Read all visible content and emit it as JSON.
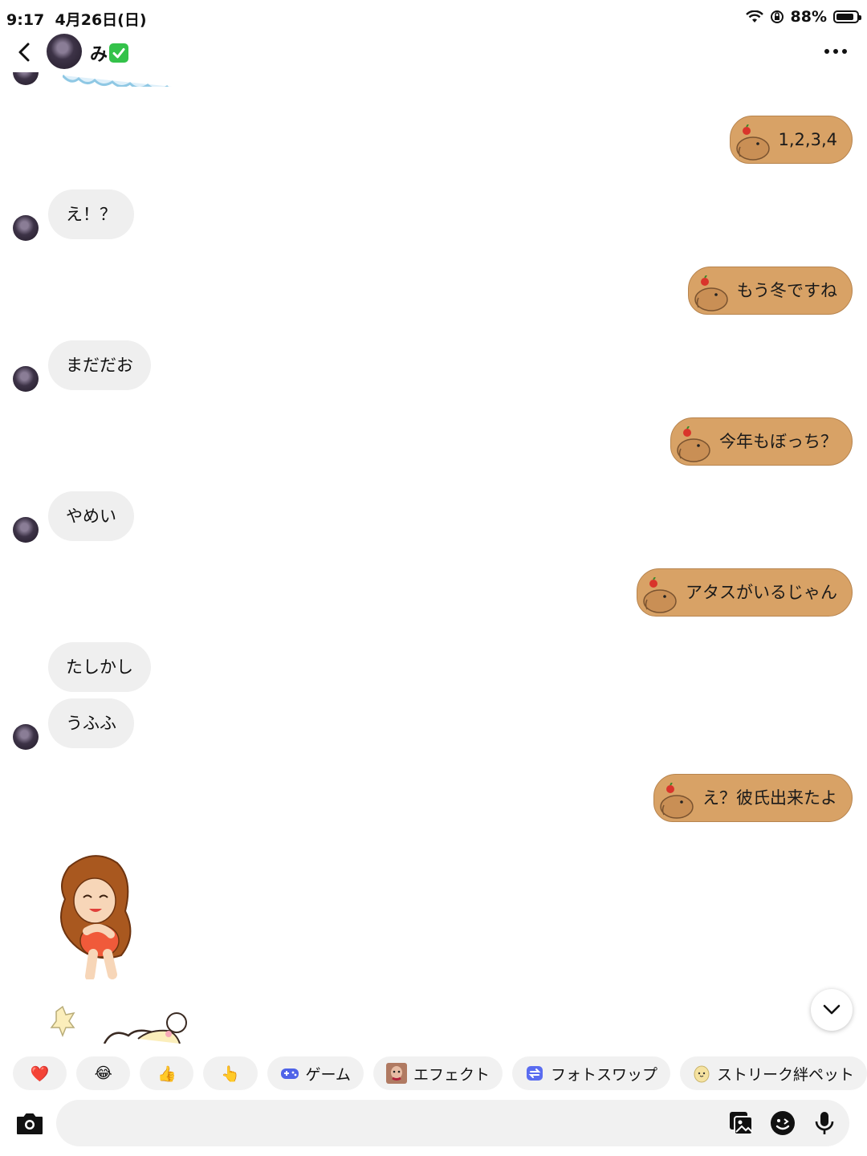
{
  "status_bar": {
    "time": "9:17",
    "date": "4月26日(日)",
    "battery": "88%",
    "battery_level": 0.88
  },
  "header": {
    "contact_name": "み",
    "verified_emoji": "✅",
    "back_icon": "chevron-left-icon",
    "more_icon": "ellipsis-icon"
  },
  "messages": [
    {
      "direction": "outgoing",
      "text": "1,2,3,4"
    },
    {
      "direction": "incoming",
      "text": "え！？"
    },
    {
      "direction": "outgoing",
      "text": "もう冬ですね"
    },
    {
      "direction": "incoming",
      "text": "まだだお"
    },
    {
      "direction": "outgoing",
      "text": "今年もぼっち？"
    },
    {
      "direction": "incoming",
      "text": "やめい"
    },
    {
      "direction": "outgoing",
      "text": "アタスがいるじゃん"
    },
    {
      "direction": "incoming",
      "text": "たしかし"
    },
    {
      "direction": "incoming",
      "text": "うふふ"
    },
    {
      "direction": "outgoing",
      "text": "え？彼氏出来たよ"
    }
  ],
  "quick_actions": [
    {
      "type": "emoji",
      "label": "❤️",
      "icon": "heart"
    },
    {
      "type": "emoji",
      "label": "😂",
      "icon": "tears-of-joy"
    },
    {
      "type": "emoji",
      "label": "👍",
      "icon": "thumbs-up"
    },
    {
      "type": "emoji",
      "label": "👆",
      "icon": "pointing-up"
    },
    {
      "type": "chip",
      "label": "ゲーム",
      "icon": "gamepad-icon"
    },
    {
      "type": "chip",
      "label": "エフェクト",
      "icon": "effect-thumbnail-icon"
    },
    {
      "type": "chip",
      "label": "フォトスワップ",
      "icon": "photo-swap-icon"
    },
    {
      "type": "chip",
      "label": "ストリーク絆ペット",
      "icon": "pet-egg-icon"
    }
  ],
  "composer": {
    "placeholder": "",
    "camera_icon": "camera-icon",
    "tools": [
      "gallery-icon",
      "sticker-icon",
      "microphone-icon"
    ]
  },
  "colors": {
    "outgoing_bubble": "#d8a266",
    "incoming_bubble": "#efefef",
    "chip_bg": "#f1f1f1"
  }
}
